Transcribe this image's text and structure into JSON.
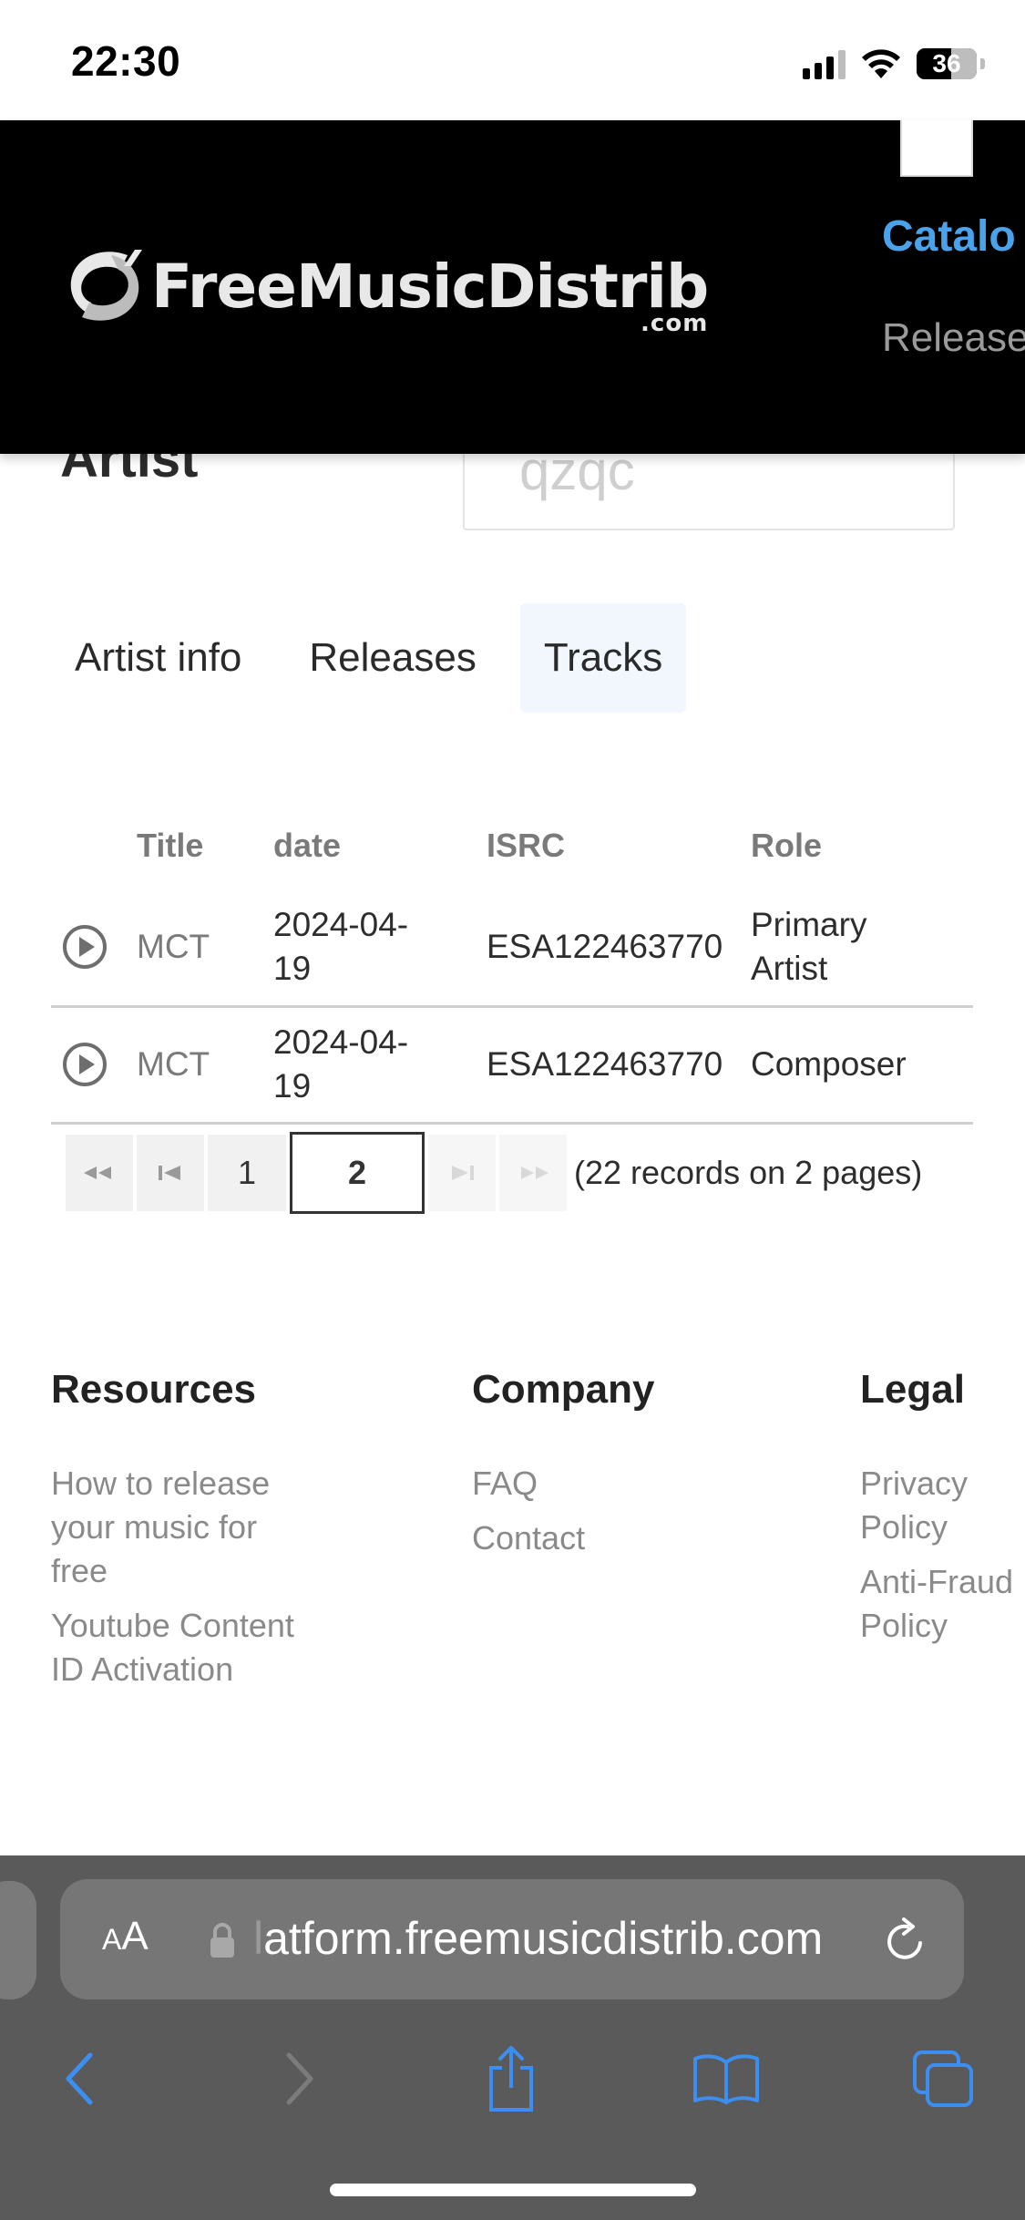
{
  "status_bar": {
    "time": "22:30",
    "battery": "36"
  },
  "header": {
    "logo_text": "FreeMusicDistrib",
    "logo_suffix": ".com",
    "nav_catalog": "Catalo",
    "nav_releases": "Release"
  },
  "artist": {
    "label": "Artist",
    "input_value": "qzqc"
  },
  "tabs": [
    {
      "label": "Artist info",
      "active": false
    },
    {
      "label": "Releases",
      "active": false
    },
    {
      "label": "Tracks",
      "active": true
    }
  ],
  "table": {
    "headers": {
      "title": "Title",
      "date": "date",
      "isrc": "ISRC",
      "role": "Role"
    },
    "rows": [
      {
        "title": "MCT",
        "date_line1": "2024-04-",
        "date_line2": "19",
        "isrc": "ESA122463770",
        "role_line1": "Primary",
        "role_line2": "Artist"
      },
      {
        "title": "MCT",
        "date_line1": "2024-04-",
        "date_line2": "19",
        "isrc": "ESA122463770",
        "role_line1": "Composer",
        "role_line2": ""
      }
    ]
  },
  "pagination": {
    "first": "<<",
    "prev": "|<",
    "page1": "1",
    "current": "2",
    "next": ">|",
    "last": ">>",
    "info": "(22 records on 2 pages)"
  },
  "footer": {
    "resources": {
      "heading": "Resources",
      "links": [
        "How to release your music for free",
        "Youtube Content ID Activation"
      ]
    },
    "company": {
      "heading": "Company",
      "links": [
        "FAQ",
        "Contact"
      ]
    },
    "legal": {
      "heading": "Legal",
      "links": [
        "Privacy Policy",
        "Anti-Fraud Policy"
      ]
    }
  },
  "browser": {
    "aa_big": "A",
    "aa_small": "A",
    "url_fade": "l",
    "url": "atform.freemusicdistrib.com"
  },
  "colors": {
    "accent": "#4aa3ea",
    "header_bg": "#000000",
    "browser_bg": "#5a5a5a",
    "ios_blue": "#3c8ef0"
  }
}
